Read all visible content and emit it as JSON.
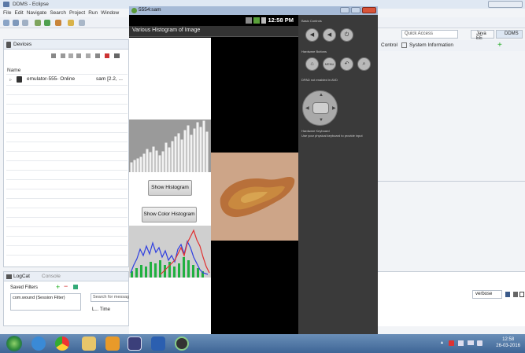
{
  "eclipse": {
    "title": "DDMS - Eclipse",
    "menu": [
      "File",
      "Edit",
      "Navigate",
      "Search",
      "Project",
      "Run",
      "Window"
    ],
    "devices_tab": "Devices",
    "name_header": "Name",
    "device_name": "emulator-555- Online",
    "device_avd": "sam [2.2, ...",
    "quick_access": "Quick Access",
    "control_label": "Control",
    "system_info_label": "System Information",
    "perspective_java": "Java EE",
    "perspective_ddms": "DDMS",
    "logcat_tab": "LogCat",
    "console_tab": "Console",
    "saved_filters": "Saved Filters",
    "session_filter": "com.wound (Session Filter)",
    "search_placeholder": "Search for messag",
    "time_col": "L... Time",
    "verbose": "verbose"
  },
  "emulator": {
    "window_title": "5554:sam",
    "clock": "12:58 PM",
    "app_title": "Various Histogram of Image",
    "show_histogram": "Show Histogram",
    "show_color_histogram": "Show Color Histogram",
    "basic_controls": "Basic Controls",
    "hardware_buttons": "Hardware Buttons",
    "dpad_disabled": "DPAD not enabled in AVD",
    "hardware_keyboard": "Hardware Keyboard",
    "keyboard_hint": "Use your physical keyboard to provide input",
    "menu_btn": "MENU"
  },
  "taskbar": {
    "time": "12:58",
    "date": "26-03-2016"
  },
  "colors": {
    "accent": "#3e6596",
    "histogram_red": "#e03030",
    "histogram_green": "#20b040",
    "histogram_blue": "#3040e0"
  }
}
